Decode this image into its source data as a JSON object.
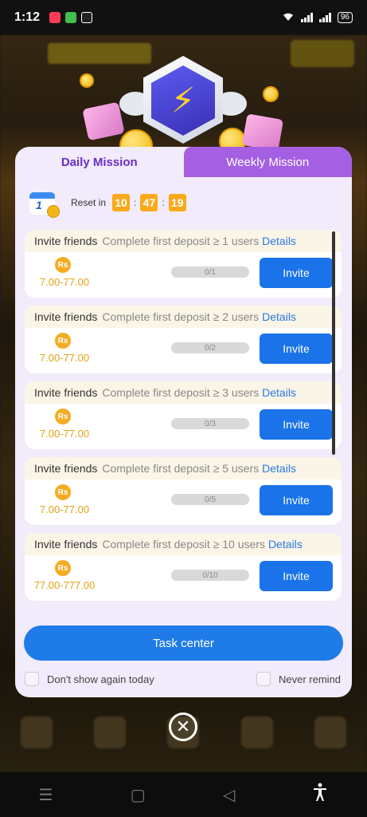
{
  "status_bar": {
    "time": "1:12",
    "battery": "96"
  },
  "modal": {
    "tabs": [
      {
        "label": "Daily Mission"
      },
      {
        "label": "Weekly Mission"
      }
    ],
    "reset": {
      "calendar_day": "1",
      "label": "Reset in",
      "hours": "10",
      "minutes": "47",
      "seconds": "19"
    },
    "missions": [
      {
        "title": "Invite friends",
        "desc": "Complete first deposit ≥ 1 users",
        "details": "Details",
        "currency": "Rs",
        "reward": "7.00-77.00",
        "progress": "0/1",
        "button": "Invite"
      },
      {
        "title": "Invite friends",
        "desc": "Complete first deposit ≥ 2 users",
        "details": "Details",
        "currency": "Rs",
        "reward": "7.00-77.00",
        "progress": "0/2",
        "button": "Invite"
      },
      {
        "title": "Invite friends",
        "desc": "Complete first deposit ≥ 3 users",
        "details": "Details",
        "currency": "Rs",
        "reward": "7.00-77.00",
        "progress": "0/3",
        "button": "Invite"
      },
      {
        "title": "Invite friends",
        "desc": "Complete first deposit ≥ 5 users",
        "details": "Details",
        "currency": "Rs",
        "reward": "7.00-77.00",
        "progress": "0/5",
        "button": "Invite"
      },
      {
        "title": "Invite friends",
        "desc": "Complete first deposit ≥ 10 users",
        "details": "Details",
        "currency": "Rs",
        "reward": "77.00-777.00",
        "progress": "0/10",
        "button": "Invite"
      }
    ],
    "task_center_label": "Task center",
    "dont_show_label": "Don't show again today",
    "never_remind_label": "Never remind"
  },
  "colors": {
    "accent_blue": "#1a73e8",
    "tab_purple": "#a55fe3",
    "timer_orange": "#f9a91b",
    "reward_gold": "#e0a415"
  },
  "icons": [
    "lightning-badge-icon",
    "calendar-icon",
    "rupee-coin-icon",
    "close-icon",
    "menu-icon",
    "home-icon",
    "back-icon",
    "accessibility-icon"
  ]
}
